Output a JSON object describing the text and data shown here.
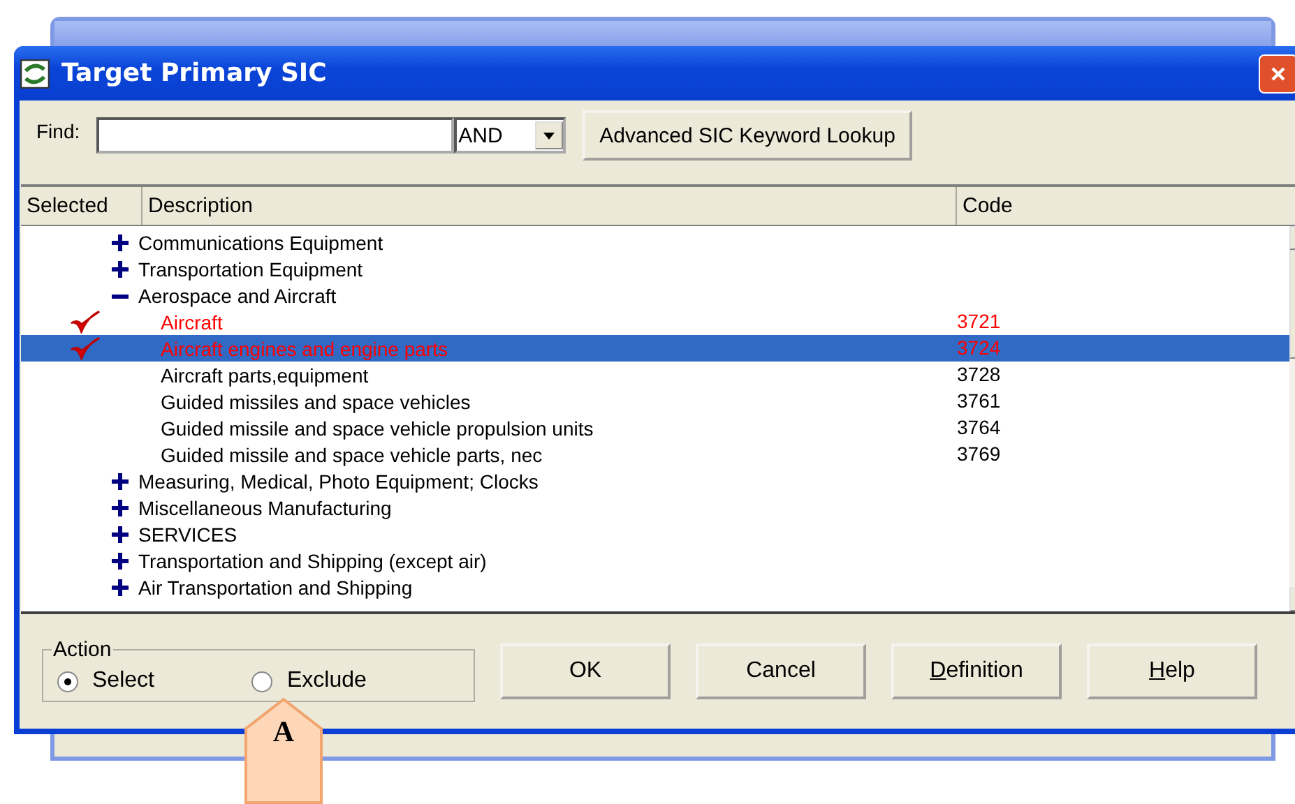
{
  "window": {
    "title": "Target Primary SIC"
  },
  "find": {
    "label": "Find:",
    "operator": "AND",
    "lookup_button": "Advanced SIC Keyword Lookup"
  },
  "table": {
    "columns": [
      "Selected",
      "Description",
      "Code"
    ],
    "rows": [
      {
        "label": "Communications Equipment",
        "expanded": false,
        "selected": false,
        "children": []
      },
      {
        "label": "Transportation Equipment",
        "expanded": false,
        "selected": false,
        "children": []
      },
      {
        "label": "Aerospace and Aircraft",
        "expanded": true,
        "selected": false,
        "children": [
          {
            "label": "Aircraft",
            "code": "3721",
            "checked": true,
            "selected": false
          },
          {
            "label": "Aircraft engines and engine parts",
            "code": "3724",
            "checked": true,
            "selected": true
          },
          {
            "label": "Aircraft parts,equipment",
            "code": "3728",
            "checked": false,
            "selected": false
          },
          {
            "label": "Guided missiles and space vehicles",
            "code": "3761",
            "checked": false,
            "selected": false
          },
          {
            "label": "Guided missile and space vehicle propulsion units",
            "code": "3764",
            "checked": false,
            "selected": false
          },
          {
            "label": "Guided missile and space vehicle parts, nec",
            "code": "3769",
            "checked": false,
            "selected": false
          }
        ]
      },
      {
        "label": "Measuring, Medical, Photo Equipment; Clocks",
        "expanded": false,
        "selected": false,
        "children": []
      },
      {
        "label": "Miscellaneous Manufacturing",
        "expanded": false,
        "selected": false,
        "children": []
      },
      {
        "label": "SERVICES",
        "expanded": false,
        "selected": false,
        "children": []
      },
      {
        "label": "Transportation and Shipping (except air)",
        "expanded": false,
        "selected": false,
        "children": []
      },
      {
        "label": "Air Transportation and Shipping",
        "expanded": false,
        "selected": false,
        "children": []
      }
    ]
  },
  "action": {
    "label": "Action",
    "options": [
      {
        "label": "Select",
        "selected": true
      },
      {
        "label": "Exclude",
        "selected": false
      }
    ]
  },
  "buttons": [
    {
      "label": "OK",
      "access_key": false
    },
    {
      "label": "Cancel",
      "access_key": false
    },
    {
      "label": "Definition",
      "access_key": true
    },
    {
      "label": "Help",
      "access_key": true
    }
  ],
  "callout": {
    "label": "A"
  }
}
